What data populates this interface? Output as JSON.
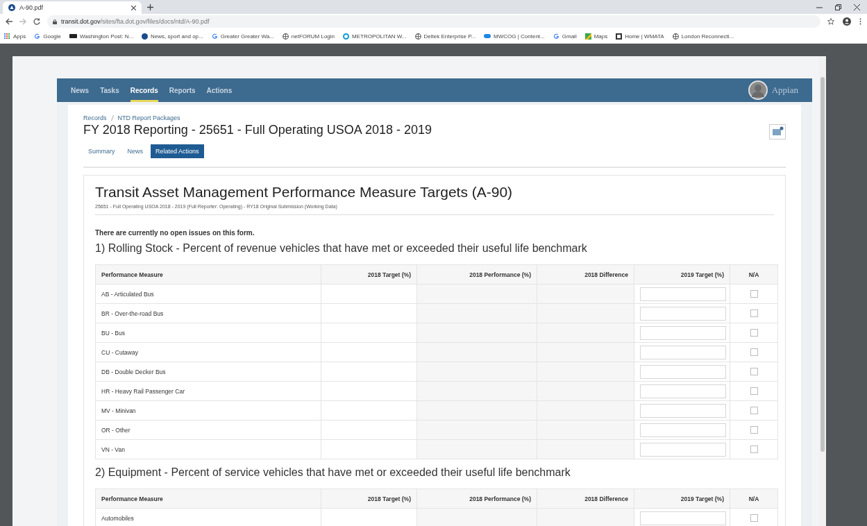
{
  "browser": {
    "tab_title": "A-90.pdf",
    "url_host": "transit.dot.gov",
    "url_path": "/sites/fta.dot.gov/files/docs/ntd/A-90.pdf",
    "bookmarks": [
      {
        "label": "Apps",
        "kind": "grid"
      },
      {
        "label": "Google",
        "kind": "g"
      },
      {
        "label": "Washington Post: N...",
        "kind": "wp"
      },
      {
        "label": "News, sport and op...",
        "kind": "bluecircle"
      },
      {
        "label": "Greater Greater Wa...",
        "kind": "g"
      },
      {
        "label": "netFORUM Login",
        "kind": "globe"
      },
      {
        "label": "METROPOLITAN W...",
        "kind": "ring"
      },
      {
        "label": "Deltek Enterprise P...",
        "kind": "globe"
      },
      {
        "label": "MWCOG | Content...",
        "kind": "pill"
      },
      {
        "label": "Gmail",
        "kind": "g"
      },
      {
        "label": "Maps",
        "kind": "maps"
      },
      {
        "label": "Home | WMATA",
        "kind": "square"
      },
      {
        "label": "London Reconnecti...",
        "kind": "globe"
      }
    ]
  },
  "app": {
    "nav": [
      {
        "label": "News",
        "selected": false
      },
      {
        "label": "Tasks",
        "selected": false
      },
      {
        "label": "Records",
        "selected": true
      },
      {
        "label": "Reports",
        "selected": false
      },
      {
        "label": "Actions",
        "selected": false
      }
    ],
    "user": "Appian",
    "breadcrumbs": [
      "Records",
      "NTD Report Packages"
    ],
    "title": "FY 2018 Reporting - 25651 - Full Operating USOA 2018 - 2019",
    "tabs": [
      {
        "label": "Summary",
        "selected": false
      },
      {
        "label": "News",
        "selected": false
      },
      {
        "label": "Related Actions",
        "selected": true
      }
    ],
    "form": {
      "title": "Transit Asset Management Performance Measure Targets (A-90)",
      "subtitle": "25651 - Full Operating USOA 2018 - 2019 (Full Reporter: Operating) - RY18 Original Submission (Working Data)",
      "notice": "There are currently no open issues on this form.",
      "sections": [
        {
          "heading": "1) Rolling Stock - Percent of revenue vehicles that have met or exceeded their useful life benchmark",
          "columns": [
            "Performance Measure",
            "2018 Target (%)",
            "2018 Performance (%)",
            "2018 Difference",
            "2019 Target (%)",
            "N/A"
          ],
          "rows": [
            {
              "measure": "AB - Articulated Bus",
              "na": false
            },
            {
              "measure": "BR - Over-the-road Bus",
              "na": false
            },
            {
              "measure": "BU - Bus",
              "na": false
            },
            {
              "measure": "CU - Cutaway",
              "na": false
            },
            {
              "measure": "DB - Double Decker Bus",
              "na": false
            },
            {
              "measure": "HR - Heavy Rail Passenger Car",
              "na": false
            },
            {
              "measure": "MV - Minivan",
              "na": false
            },
            {
              "measure": "OR - Other",
              "na": false
            },
            {
              "measure": "VN - Van",
              "na": false
            }
          ]
        },
        {
          "heading": "2) Equipment - Percent of service vehicles that have met or exceeded their useful life benchmark",
          "columns": [
            "Performance Measure",
            "2018 Target (%)",
            "2018 Performance (%)",
            "2018 Difference",
            "2019 Target (%)",
            "N/A"
          ],
          "rows": [
            {
              "measure": "Automobiles",
              "na": false
            }
          ]
        }
      ]
    }
  }
}
